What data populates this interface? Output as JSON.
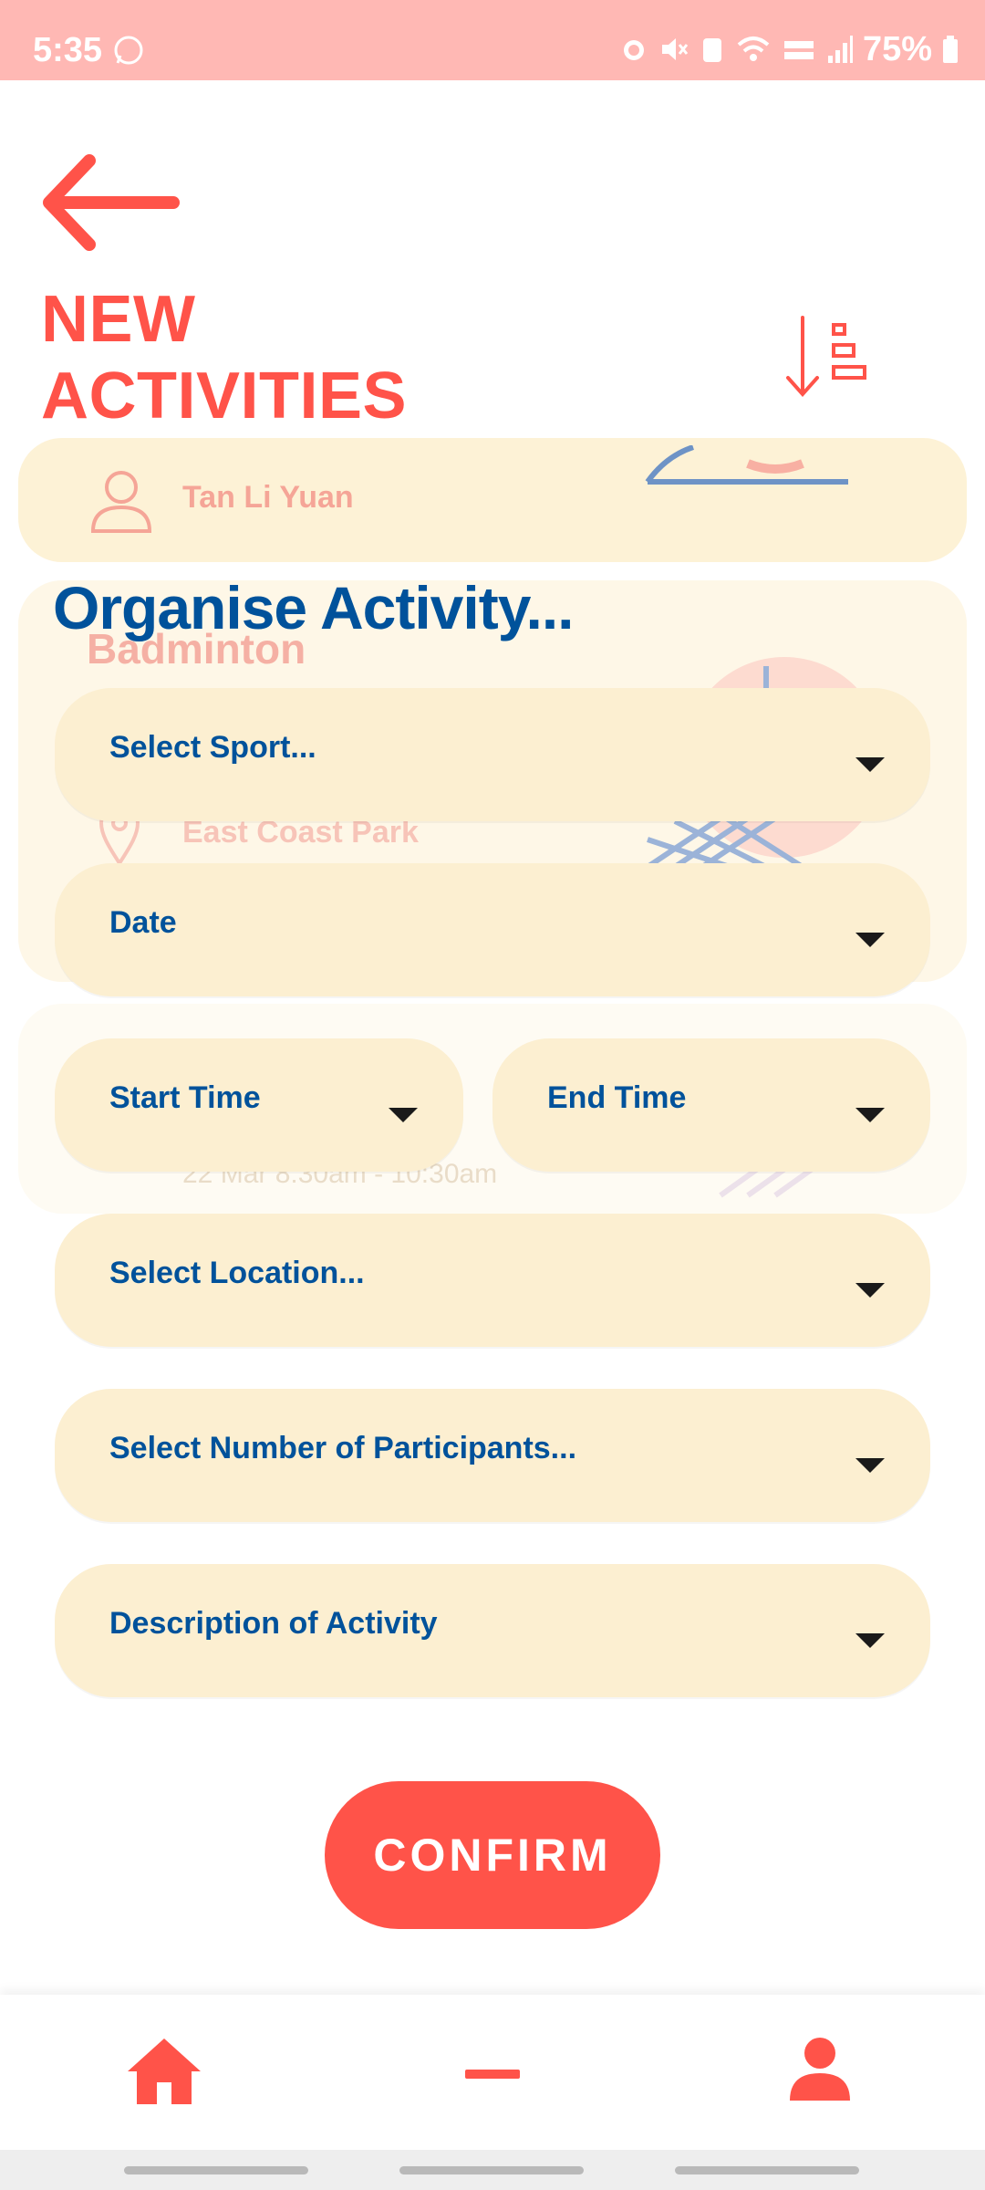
{
  "status_bar": {
    "time": "5:35",
    "battery": "75%"
  },
  "header": {
    "title_line1": "NEW",
    "title_line2": "ACTIVITIES"
  },
  "background_card": {
    "organiser": "Tan Li Yuan",
    "sport": "Badminton",
    "location": "East Coast Park",
    "time_text": "22 Mar  8:30am - 10:30am"
  },
  "form": {
    "heading": "Organise Activity...",
    "sport_placeholder": "Select Sport...",
    "date_placeholder": "Date",
    "start_time_placeholder": "Start Time",
    "end_time_placeholder": "End Time",
    "location_placeholder": "Select Location...",
    "participants_placeholder": "Select Number of Participants...",
    "description_placeholder": "Description of Activity"
  },
  "actions": {
    "confirm_label": "CONFIRM"
  },
  "colors": {
    "accent": "#ff5349",
    "primary_text": "#00529b",
    "field_bg": "#fcefd1",
    "status_bar": "#ffb8b4"
  },
  "icons": {
    "back": "arrow-left-icon",
    "sort": "sort-descending-icon",
    "home": "home-icon",
    "minus": "minus-icon",
    "profile": "profile-icon"
  }
}
